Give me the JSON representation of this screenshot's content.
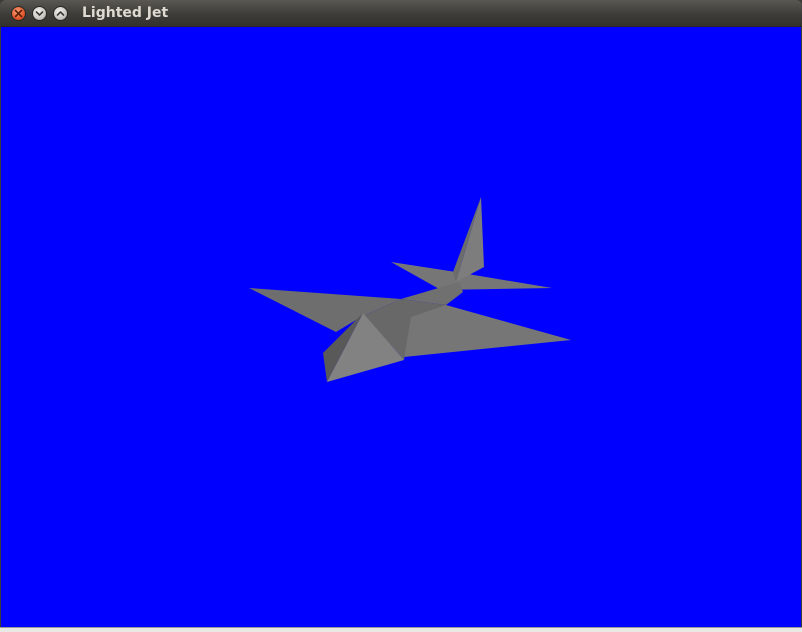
{
  "window": {
    "title": "Lighted Jet",
    "buttons": {
      "close_icon": "close-icon",
      "minimize_icon": "minimize-icon",
      "maximize_icon": "maximize-icon"
    }
  },
  "scene": {
    "background_color": "#0000ff",
    "object": "jet",
    "object_color": "#808080"
  }
}
